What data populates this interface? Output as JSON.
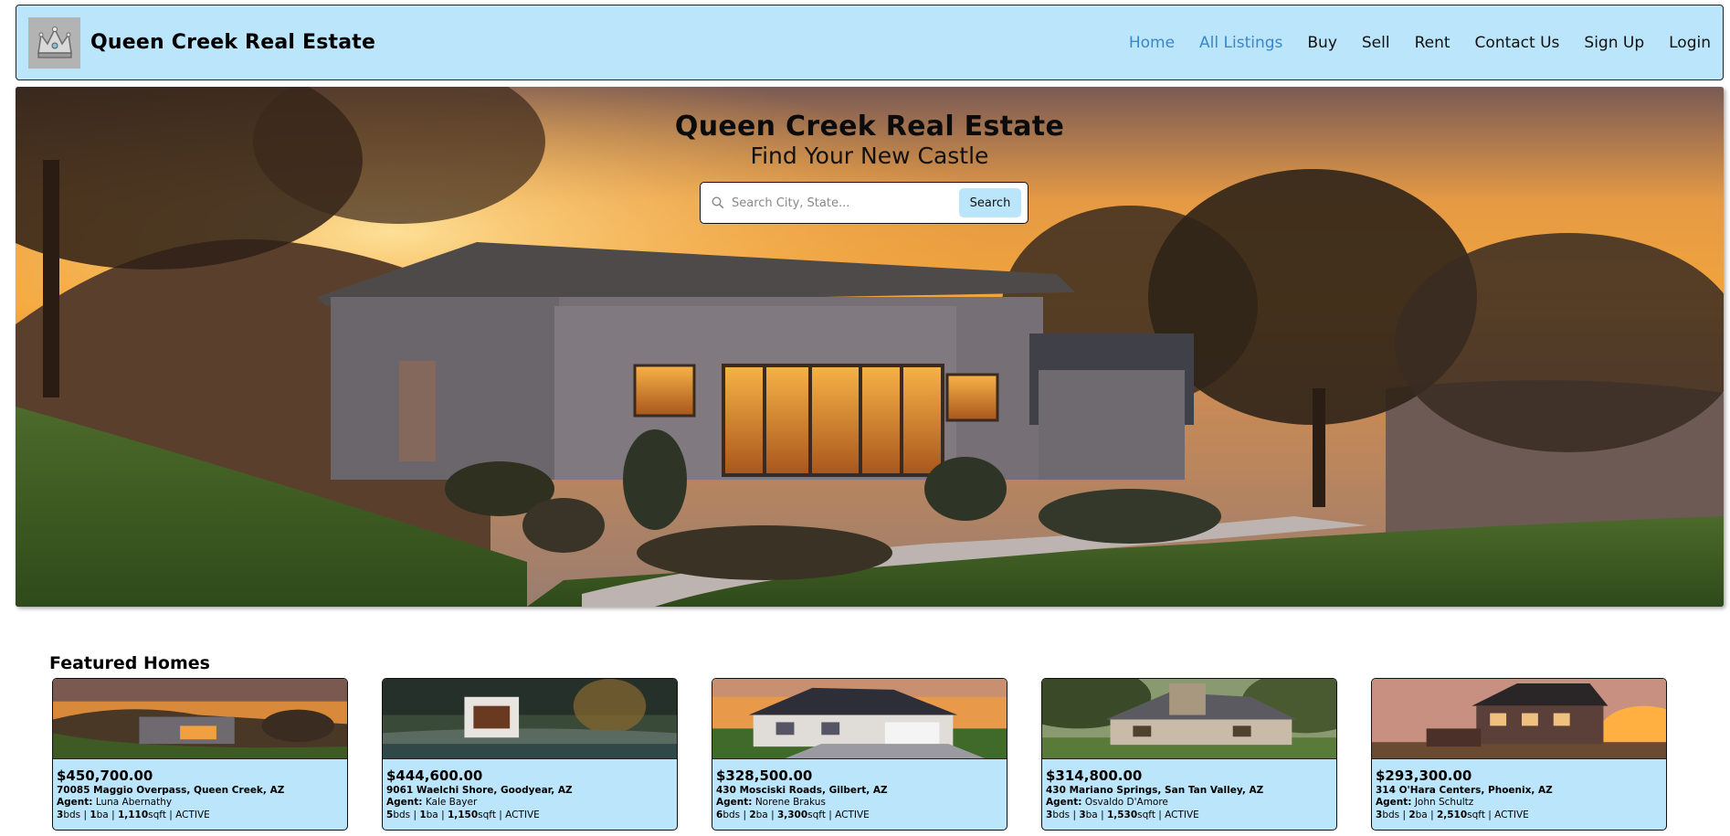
{
  "header": {
    "brand": "Queen Creek Real Estate",
    "nav": [
      {
        "label": "Home",
        "active": true
      },
      {
        "label": "All Listings",
        "active": true
      },
      {
        "label": "Buy",
        "active": false
      },
      {
        "label": "Sell",
        "active": false
      },
      {
        "label": "Rent",
        "active": false
      },
      {
        "label": "Contact Us",
        "active": false
      },
      {
        "label": "Sign Up",
        "active": false
      },
      {
        "label": "Login",
        "active": false
      }
    ]
  },
  "hero": {
    "title": "Queen Creek Real Estate",
    "subtitle": "Find Your New Castle",
    "search": {
      "placeholder": "Search City, State...",
      "value": "",
      "button_label": "Search"
    }
  },
  "featured": {
    "title": "Featured Homes",
    "agent_label": "Agent:",
    "listings": [
      {
        "price": "$450,700.00",
        "address": "70085 Maggio Overpass, Queen Creek, AZ",
        "agent": "Luna Abernathy",
        "beds": "3",
        "baths": "1",
        "sqft": "1,110",
        "status": "ACTIVE"
      },
      {
        "price": "$444,600.00",
        "address": "9061 Waelchi Shore, Goodyear, AZ",
        "agent": "Kale Bayer",
        "beds": "5",
        "baths": "1",
        "sqft": "1,150",
        "status": "ACTIVE"
      },
      {
        "price": "$328,500.00",
        "address": "430 Mosciski Roads, Gilbert, AZ",
        "agent": "Norene Brakus",
        "beds": "6",
        "baths": "2",
        "sqft": "3,300",
        "status": "ACTIVE"
      },
      {
        "price": "$314,800.00",
        "address": "430 Mariano Springs, San Tan Valley, AZ",
        "agent": "Osvaldo D'Amore",
        "beds": "3",
        "baths": "3",
        "sqft": "1,530",
        "status": "ACTIVE"
      },
      {
        "price": "$293,300.00",
        "address": "314 O'Hara Centers, Phoenix, AZ",
        "agent": "John Schultz",
        "beds": "3",
        "baths": "2",
        "sqft": "2,510",
        "status": "ACTIVE"
      }
    ]
  },
  "colors": {
    "accent": "#bbe5fa",
    "nav_active": "#3a86c8"
  },
  "icons": {
    "logo": "crown-icon",
    "search": "search-icon"
  }
}
